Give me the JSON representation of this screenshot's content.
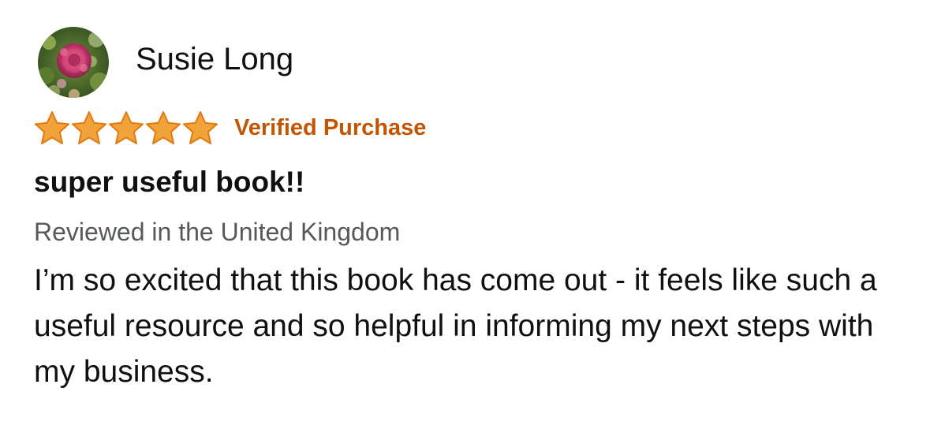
{
  "review": {
    "profile": {
      "name": "Susie Long",
      "avatar_icon": "flower-avatar-icon"
    },
    "rating": {
      "stars": 5,
      "max_stars": 5,
      "star_color": "#f0a33a",
      "star_outline_color": "#e47911"
    },
    "verified_label": "Verified Purchase",
    "verified_color": "#c45500",
    "title": "super useful book!!",
    "meta": "Reviewed in the United Kingdom",
    "body": "I’m so excited that this book has come out - it feels like such a useful resource and so helpful in informing my next steps with my business."
  }
}
